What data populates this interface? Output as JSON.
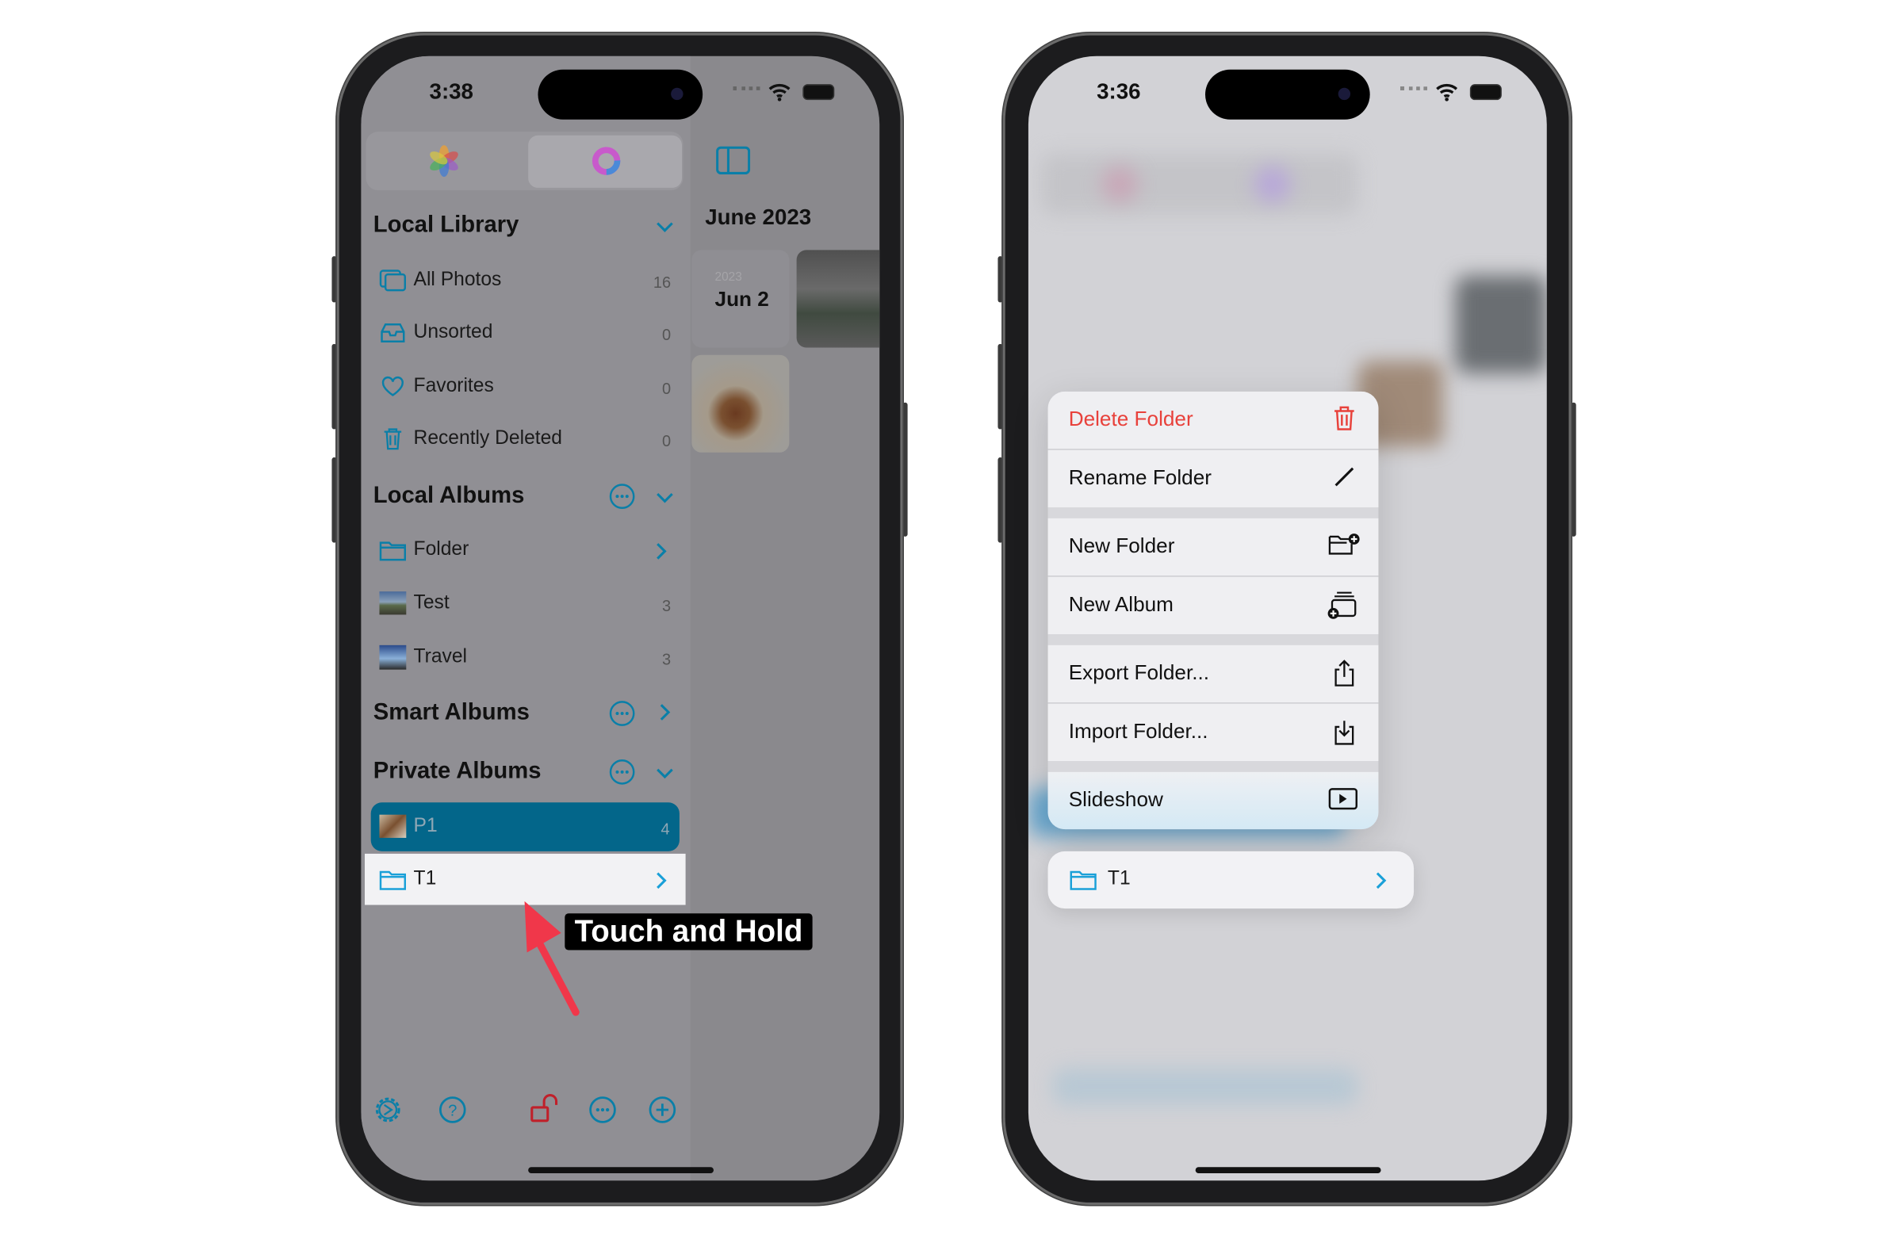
{
  "left_phone": {
    "status": {
      "time": "3:38"
    },
    "sidebar": {
      "local_library": {
        "title": "Local Library",
        "items": [
          {
            "label": "All Photos",
            "count": "16"
          },
          {
            "label": "Unsorted",
            "count": "0"
          },
          {
            "label": "Favorites",
            "count": "0"
          },
          {
            "label": "Recently Deleted",
            "count": "0"
          }
        ]
      },
      "local_albums": {
        "title": "Local Albums",
        "items": [
          {
            "label": "Folder"
          },
          {
            "label": "Test",
            "count": "3"
          },
          {
            "label": "Travel",
            "count": "3"
          }
        ]
      },
      "smart_albums": {
        "title": "Smart Albums"
      },
      "private_albums": {
        "title": "Private Albums",
        "items": [
          {
            "label": "P1",
            "count": "4"
          },
          {
            "label": "T1"
          }
        ]
      }
    },
    "content": {
      "month_title": "June 2023",
      "date_card": {
        "year": "2023",
        "day": "Jun 2"
      }
    },
    "annotation": "Touch and Hold"
  },
  "right_phone": {
    "status": {
      "time": "3:36"
    },
    "context_menu": [
      {
        "label": "Delete Folder",
        "icon": "trash-icon",
        "destructive": true
      },
      {
        "label": "Rename Folder",
        "icon": "pencil-icon"
      },
      {
        "label": "New Folder",
        "icon": "folder-plus-icon"
      },
      {
        "label": "New Album",
        "icon": "album-plus-icon"
      },
      {
        "label": "Export Folder...",
        "icon": "share-icon"
      },
      {
        "label": "Import Folder...",
        "icon": "import-icon"
      },
      {
        "label": "Slideshow",
        "icon": "play-rectangle-icon"
      }
    ],
    "preview_row": {
      "label": "T1"
    }
  },
  "colors": {
    "accent": "#1a9fd0",
    "destructive": "#e8413b",
    "selected_row": "#03668a",
    "annotation_arrow": "#f0374a"
  }
}
